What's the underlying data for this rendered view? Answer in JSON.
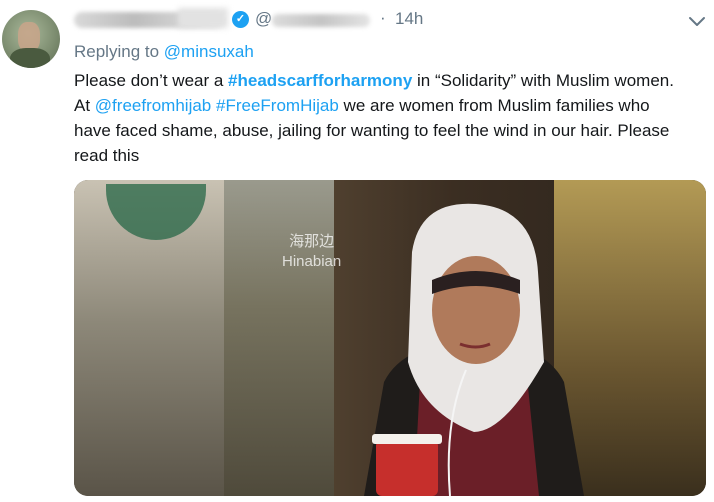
{
  "tweet": {
    "time": "14h",
    "at_symbol": "@",
    "dot": "·",
    "replying_label": "Replying to",
    "replying_handle": "@minsuxah",
    "line1_pre": "Please don’t wear a ",
    "line1_tag": "#headscarfforharmony",
    "line1_post": " in “Solidarity” with Muslim women.",
    "line2_pre": "At ",
    "line2_mention": "@freefromhijab",
    "line2_space": " ",
    "line2_tag": "#FreeFromHijab",
    "line2_post": " we are women from Muslim families who",
    "line3": "have faced shame, abuse, jailing for wanting to feel the wind in our hair. Please",
    "line4": "read this"
  },
  "media": {
    "watermark_cn": "海那边",
    "watermark_en": "Hinabian"
  },
  "icons": {
    "verified": "verified-badge-icon",
    "menu": "chevron-down-icon"
  },
  "colors": {
    "link": "#1da1f2",
    "muted": "#657786",
    "text": "#14171a"
  }
}
